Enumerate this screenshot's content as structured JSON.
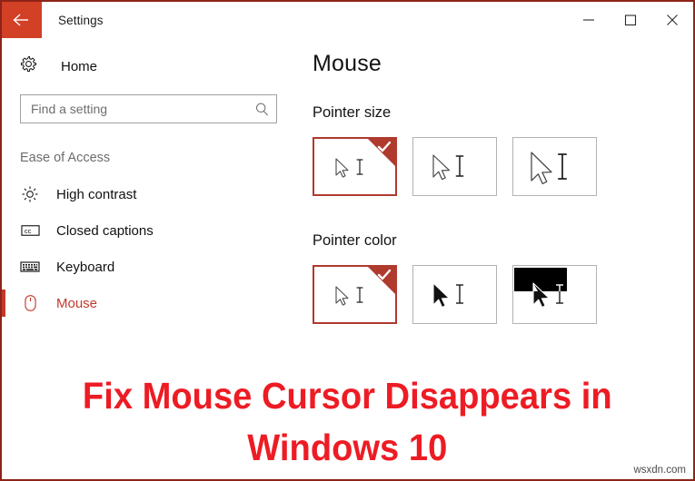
{
  "window": {
    "title": "Settings",
    "back_icon": "back-arrow-icon",
    "minimize_label": "─",
    "maximize_label": "□",
    "close_label": "✕",
    "frame_border_color": "#8d2318",
    "back_button_color": "#d24026"
  },
  "sidebar": {
    "home": {
      "label": "Home",
      "icon": "gear-icon"
    },
    "search": {
      "value": "",
      "placeholder": "Find a setting",
      "icon": "search-icon"
    },
    "group_header": "Ease of Access",
    "items": [
      {
        "label": "High contrast",
        "icon": "brightness-icon",
        "selected": false
      },
      {
        "label": "Closed captions",
        "icon": "closed-captions-icon",
        "selected": false
      },
      {
        "label": "Keyboard",
        "icon": "keyboard-icon",
        "selected": false
      },
      {
        "label": "Mouse",
        "icon": "mouse-icon",
        "selected": true
      }
    ],
    "accent_color": "#c0392b"
  },
  "main": {
    "page_title": "Mouse",
    "sections": [
      {
        "title": "Pointer size",
        "options": [
          {
            "name": "pointer-size-small",
            "selected": true
          },
          {
            "name": "pointer-size-medium",
            "selected": false
          },
          {
            "name": "pointer-size-large",
            "selected": false
          }
        ]
      },
      {
        "title": "Pointer color",
        "options": [
          {
            "name": "pointer-color-white",
            "selected": true
          },
          {
            "name": "pointer-color-black",
            "selected": false
          },
          {
            "name": "pointer-color-inverted",
            "selected": false
          }
        ]
      }
    ],
    "selected_tile_color": "#b03a2e",
    "tile_border_color": "#b2b2b2"
  },
  "caption": {
    "line1": "Fix Mouse Cursor Disappears in",
    "line2": "Windows 10",
    "color": "#ed1c24"
  },
  "watermark": {
    "text": "wsxdn.com"
  }
}
